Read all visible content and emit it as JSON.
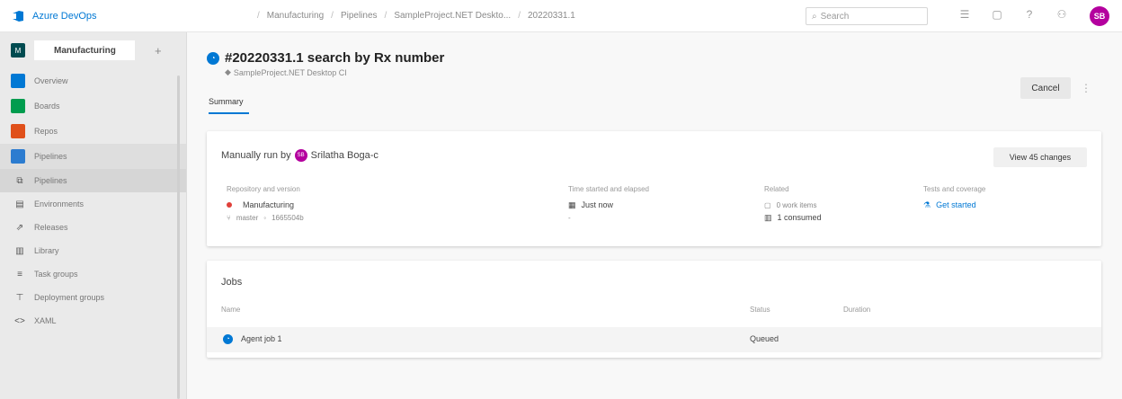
{
  "app": {
    "brand": "Azure DevOps"
  },
  "breadcrumb": [
    "Manufacturing",
    "Pipelines",
    "SampleProject.NET Deskto...",
    "20220331.1"
  ],
  "search": {
    "placeholder": "Search"
  },
  "user": {
    "initials": "SB"
  },
  "sidebar": {
    "project": {
      "initials": "M",
      "name": "Manufacturing"
    },
    "items": [
      {
        "label": "Overview",
        "icon": "overview-icon",
        "color": "#0078d4"
      },
      {
        "label": "Boards",
        "icon": "boards-icon",
        "color": "#009c4e"
      },
      {
        "label": "Repos",
        "icon": "repos-icon",
        "color": "#e0501a"
      },
      {
        "label": "Pipelines",
        "icon": "pipelines-icon",
        "color": "#2c7cd0"
      }
    ],
    "sub_items": [
      {
        "label": "Pipelines",
        "icon": "pipelines-sub-icon",
        "glyph": "⧉"
      },
      {
        "label": "Environments",
        "icon": "environments-icon",
        "glyph": "▤"
      },
      {
        "label": "Releases",
        "icon": "releases-icon",
        "glyph": "⇗"
      },
      {
        "label": "Library",
        "icon": "library-icon",
        "glyph": "▥"
      },
      {
        "label": "Task groups",
        "icon": "task-groups-icon",
        "glyph": "≡"
      },
      {
        "label": "Deployment groups",
        "icon": "deployment-groups-icon",
        "glyph": "⊤"
      },
      {
        "label": "XAML",
        "icon": "xaml-icon",
        "glyph": "<>"
      }
    ]
  },
  "run": {
    "title": "#20220331.1 search by Rx number",
    "subtitle": "SampleProject.NET Desktop CI",
    "tab": "Summary",
    "cancel_label": "Cancel"
  },
  "summary": {
    "manually_run_by": "Manually run by",
    "user_name": "Srilatha Boga-c",
    "view_changes_label": "View 45 changes",
    "repo_label": "Repository and version",
    "repo_name": "Manufacturing",
    "branch": "master",
    "commit": "1665504b",
    "time_label": "Time started and elapsed",
    "time_value": "Just now",
    "time_elapsed": "-",
    "related_label": "Related",
    "work_items": "0 work items",
    "consumed": "1 consumed",
    "tests_label": "Tests and coverage",
    "tests_link": "Get started"
  },
  "jobs": {
    "title": "Jobs",
    "columns": [
      "Name",
      "Status",
      "Duration"
    ],
    "rows": [
      {
        "name": "Agent job 1",
        "status": "Queued",
        "duration": ""
      }
    ]
  }
}
